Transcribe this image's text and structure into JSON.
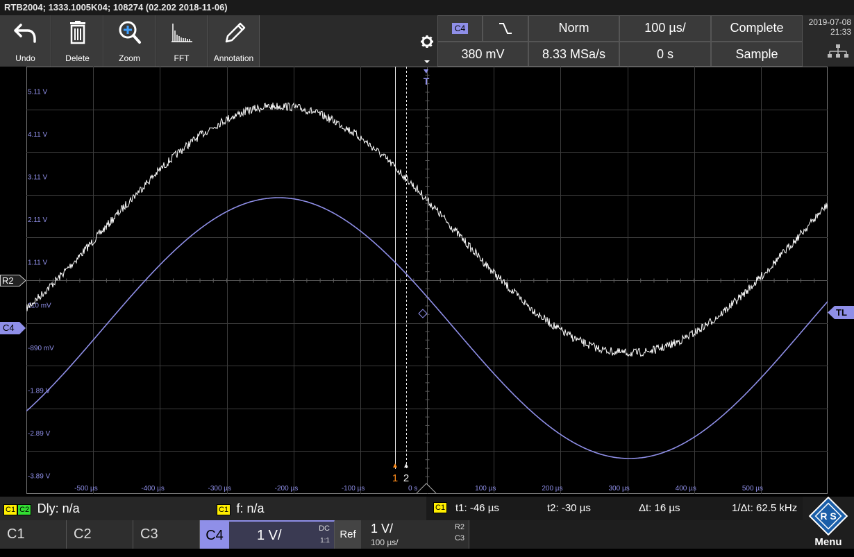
{
  "title": "RTB2004; 1333.1005K04; 108274 (02.202 2018-11-06)",
  "toolbar": [
    {
      "label": "Undo",
      "icon": "undo-icon"
    },
    {
      "label": "Delete",
      "icon": "trash-icon"
    },
    {
      "label": "Zoom",
      "icon": "zoom-icon"
    },
    {
      "label": "FFT",
      "icon": "fft-icon"
    },
    {
      "label": "Annotation",
      "icon": "pencil-icon"
    }
  ],
  "trigger": {
    "channel": "C4",
    "mode": "Norm",
    "timebase": "100 µs/",
    "status": "Complete",
    "level": "380 mV",
    "sample_rate": "8.33 MSa/s",
    "position": "0 s",
    "acq_mode": "Sample"
  },
  "datetime": {
    "date": "2019-07-08",
    "time": "21:33"
  },
  "voltage_labels": [
    "5.11 V",
    "4.11 V",
    "3.11 V",
    "2.11 V",
    "1.11 V",
    "110 mV",
    "-890 mV",
    "-1.89 V",
    "-2.89 V",
    "-3.89 V"
  ],
  "time_labels": [
    "-500 µs",
    "-400 µs",
    "-300 µs",
    "-200 µs",
    "-100 µs",
    "0 s",
    "100 µs",
    "200 µs",
    "300 µs",
    "400 µs",
    "500 µs"
  ],
  "markers": {
    "r2": "R2",
    "c4": "C4",
    "tl": "TL",
    "trigger": "T",
    "cursor1": "1",
    "cursor2": "2"
  },
  "measure": {
    "dly_tags": [
      "C1",
      "C2"
    ],
    "dly": "Dly: n/a",
    "freq_tag": "C1",
    "freq": "f: n/a",
    "cursor_tag": "C1",
    "t1": "t1: -46 µs",
    "t2": "t2: -30 µs",
    "dt": "Δt: 16 µs",
    "inv_dt": "1/Δt: 62.5 kHz"
  },
  "channels": {
    "c1": "C1",
    "c2": "C2",
    "c3": "C3",
    "c4": "C4",
    "c4_scale": "1 V/",
    "c4_coupling": "DC",
    "c4_probe": "1:1",
    "ref": "Ref",
    "ref_scale": "1 V/",
    "ref_time": "100 µs/",
    "ref_src_a": "R2",
    "ref_src_b": "C3"
  },
  "menu": "Menu",
  "colors": {
    "c4": "#8f8fe8",
    "ref": "#ffffff",
    "cursor1": "#ff8c1a",
    "cursor_tag": "#ffee00"
  }
}
